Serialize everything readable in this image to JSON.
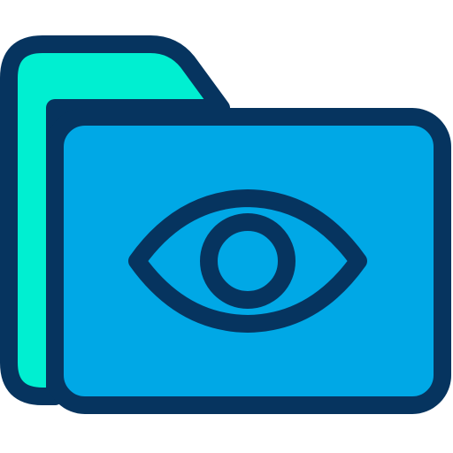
{
  "icon": {
    "name": "folder-eye-icon",
    "colors": {
      "outline": "#06345f",
      "back_tab": "#00efd1",
      "front_panel": "#00a8e6",
      "background": "#ffffff"
    }
  }
}
